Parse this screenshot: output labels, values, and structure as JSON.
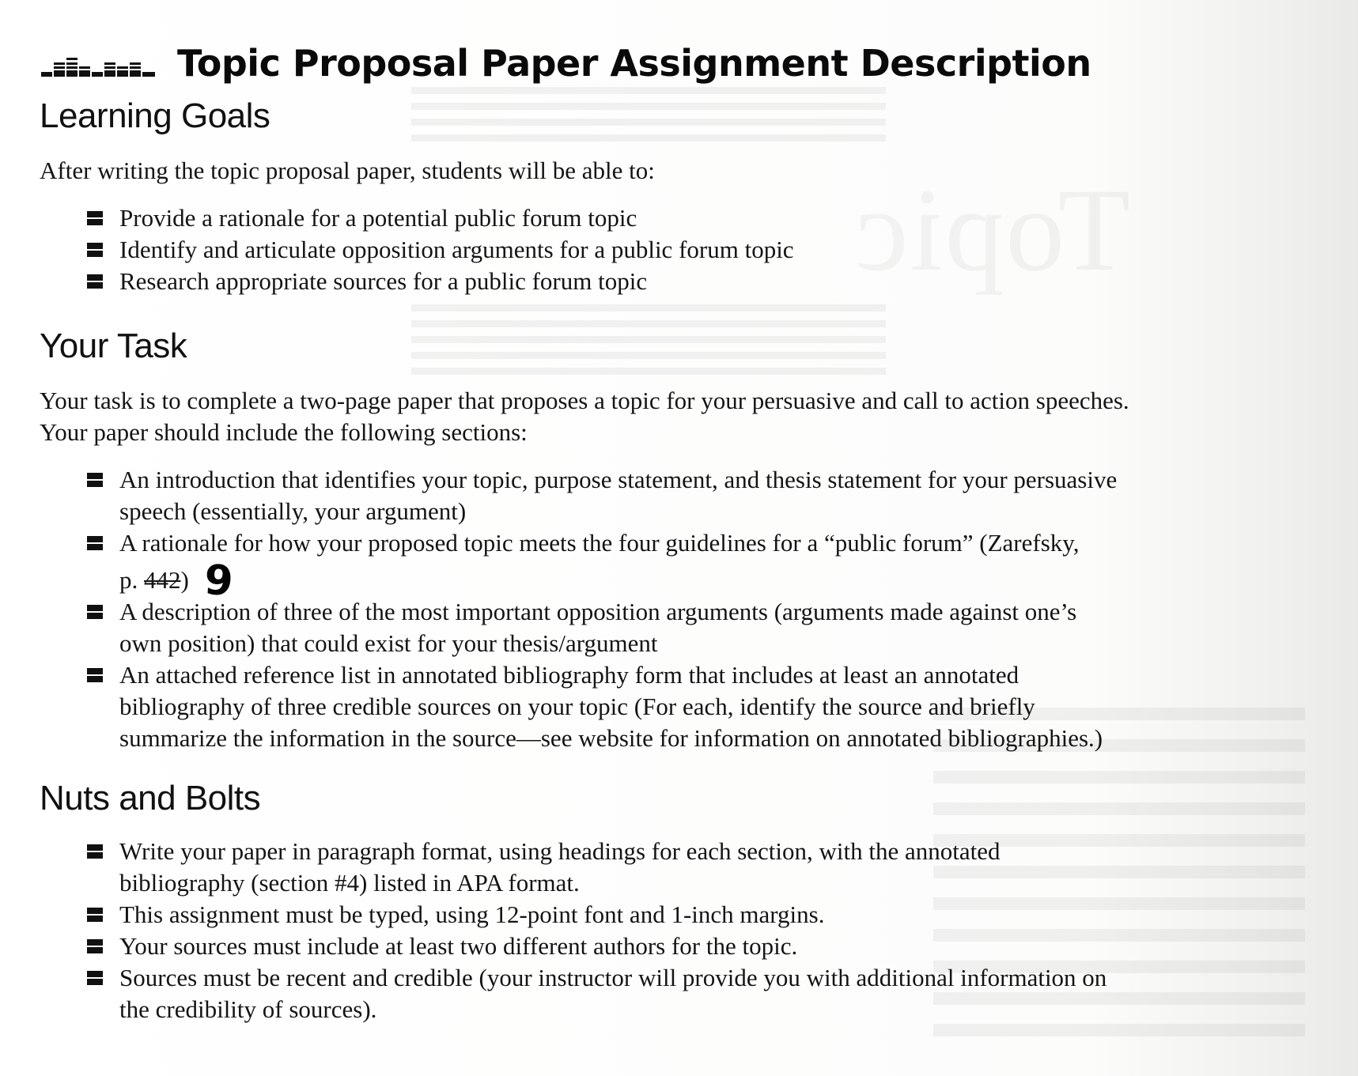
{
  "document": {
    "title": "Topic Proposal Paper Assignment Description",
    "logo_icon": "equalizer-bars-icon"
  },
  "learning_goals": {
    "heading": "Learning Goals",
    "intro": "After writing the topic proposal paper, students will be able to:",
    "items": [
      "Provide a rationale for a potential public forum topic",
      "Identify and articulate opposition arguments for a public forum topic",
      "Research appropriate sources for a public forum topic"
    ]
  },
  "your_task": {
    "heading": "Your Task",
    "intro_lines": [
      "Your task is to complete a two-page paper that proposes a topic for your persuasive and call to action speeches.",
      "Your paper should include the following sections:"
    ],
    "items": [
      {
        "lines": [
          "An introduction that identifies your topic, purpose statement, and thesis statement for your persuasive",
          "speech (essentially, your argument)"
        ]
      },
      {
        "lines": [
          "A rationale for how your proposed topic meets the four guidelines for a “public forum” (Zarefsky,"
        ],
        "page_prefix": "p. ",
        "struck_page": "442",
        "page_suffix": ")",
        "handwritten_correction": "9"
      },
      {
        "lines": [
          "A description of three of the most important opposition arguments (arguments made against one’s",
          "own position) that could exist for your thesis/argument"
        ]
      },
      {
        "lines": [
          "An attached reference list in annotated bibliography form that includes at least an annotated",
          "bibliography of three credible sources on your topic (For each, identify the source and briefly",
          "summarize the information in the source—see website for information on annotated bibliographies.)"
        ]
      }
    ]
  },
  "nuts_and_bolts": {
    "heading": "Nuts and Bolts",
    "items": [
      {
        "lines": [
          "Write your paper in paragraph format, using headings for each section, with the annotated",
          "bibliography (section #4) listed in APA format."
        ]
      },
      {
        "lines": [
          "This assignment must be typed, using 12-point font and 1-inch margins."
        ]
      },
      {
        "lines": [
          "Your sources must include at least two different authors for the topic."
        ]
      },
      {
        "lines": [
          "Sources must be recent and credible (your instructor will provide you with additional information on",
          "the credibility of sources)."
        ]
      }
    ]
  },
  "background": {
    "bleed_through_text": "Topic"
  }
}
